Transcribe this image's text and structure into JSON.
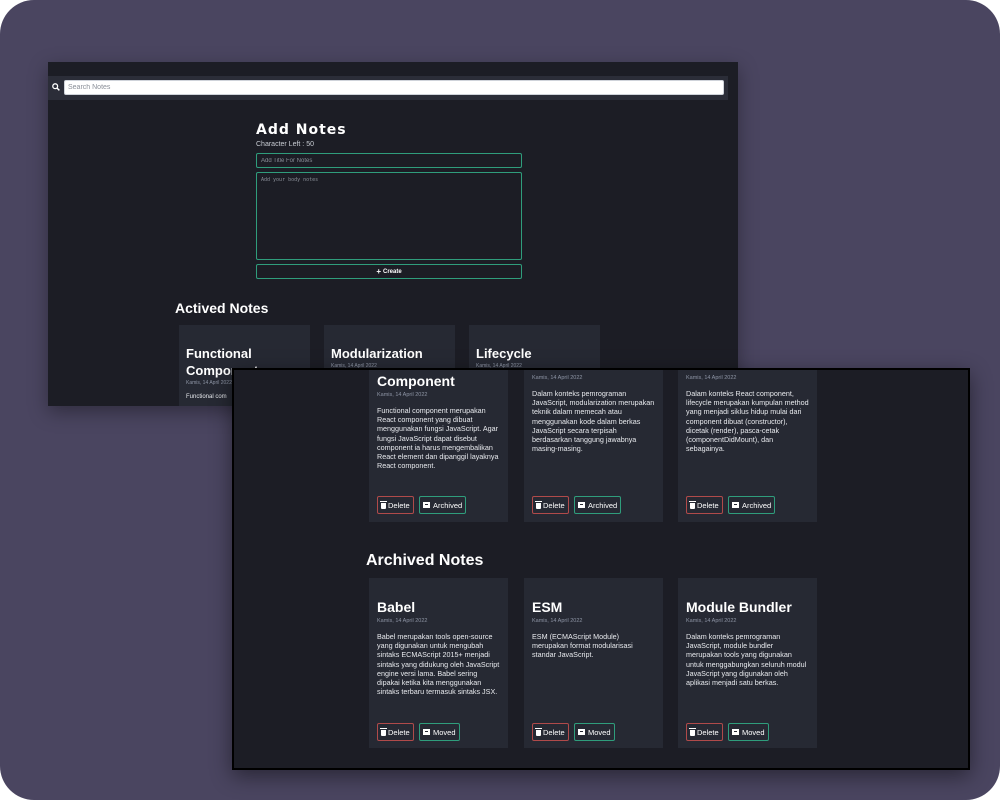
{
  "search": {
    "placeholder": "Search Notes"
  },
  "form": {
    "heading": "Add Notes",
    "char_left": "Character Left : 50",
    "title_placeholder": "Add Title For Notes",
    "body_placeholder": "Add your body notes",
    "create_label": "Create"
  },
  "active": {
    "heading": "Actived Notes",
    "notes": [
      {
        "title": "Functional Component",
        "date": "Kamis, 14 April 2022",
        "body": "Functional component merupakan React component yang dibuat menggunakan fungsi JavaScript. Agar fungsi JavaScript dapat disebut component ia harus mengembalikan React element dan dipanggil layaknya React component.",
        "body_preview": "Functional com"
      },
      {
        "title": "Modularization",
        "date": "Kamis, 14 April 2022",
        "body": "Dalam konteks pemrograman JavaScript, modularization merupakan teknik dalam memecah atau menggunakan kode dalam berkas JavaScript secara terpisah berdasarkan tanggung jawabnya masing-masing."
      },
      {
        "title": "Lifecycle",
        "date": "Kamis, 14 April 2022",
        "body": "Dalam konteks React component, lifecycle merupakan kumpulan method yang menjadi siklus hidup mulai dari component dibuat (constructor), dicetak (render), pasca-cetak (componentDidMount), dan sebagainya."
      }
    ],
    "partial_title": "Component",
    "delete_label": "Delete",
    "archive_label": "Archived"
  },
  "archived": {
    "heading": "Archived Notes",
    "notes": [
      {
        "title": "Babel",
        "date": "Kamis, 14 April 2022",
        "body": "Babel merupakan tools open-source yang digunakan untuk mengubah sintaks ECMAScript 2015+ menjadi sintaks yang didukung oleh JavaScript engine versi lama. Babel sering dipakai ketika kita menggunakan sintaks terbaru termasuk sintaks JSX."
      },
      {
        "title": "ESM",
        "date": "Kamis, 14 April 2022",
        "body": "ESM (ECMAScript Module) merupakan format modularisasi standar JavaScript."
      },
      {
        "title": "Module Bundler",
        "date": "Kamis, 14 April 2022",
        "body": "Dalam konteks pemrograman JavaScript, module bundler merupakan tools yang digunakan untuk menggabungkan seluruh modul JavaScript yang digunakan oleh aplikasi menjadi satu berkas."
      }
    ],
    "delete_label": "Delete",
    "move_label": "Moved"
  },
  "colors": {
    "frame_bg": "#4a4560",
    "app_bg": "#1c1d25",
    "card_bg": "#262933",
    "accent_green": "#2f9d7c",
    "danger_red": "#b04a4a"
  }
}
